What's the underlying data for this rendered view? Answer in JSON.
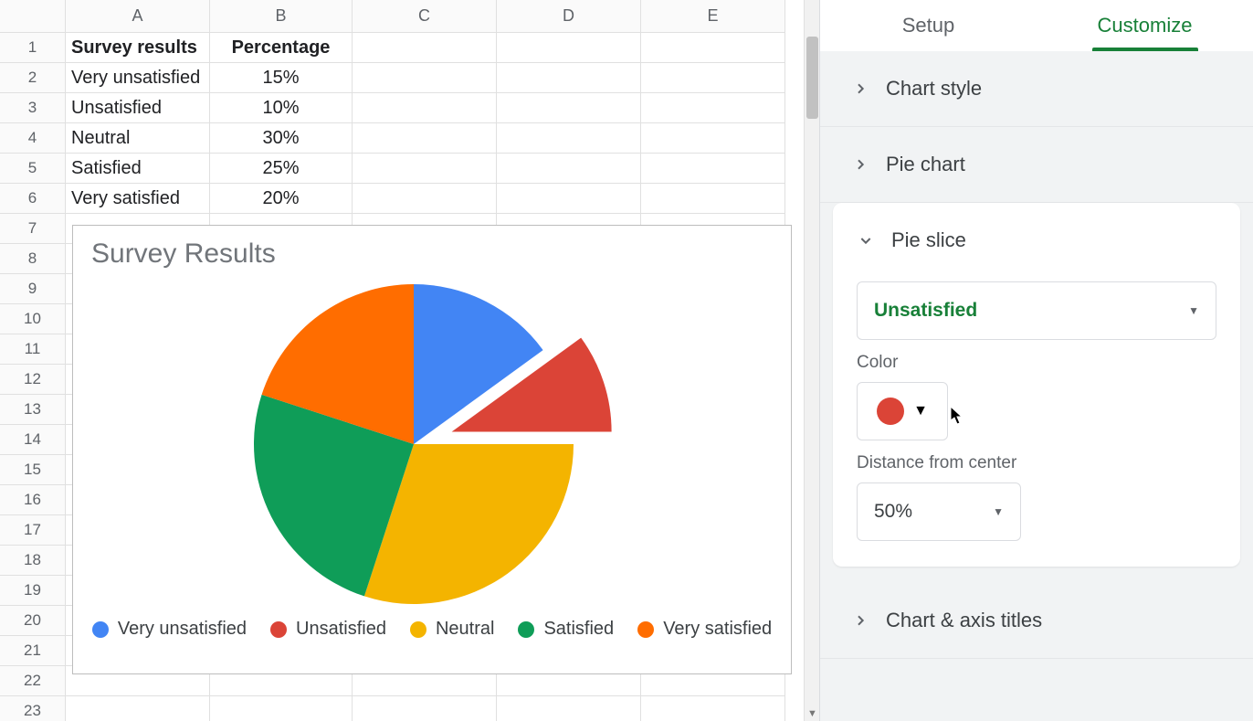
{
  "sheet": {
    "columns": [
      "A",
      "B",
      "C",
      "D",
      "E"
    ],
    "row_count": 23,
    "header_row": {
      "A": "Survey results",
      "B": "Percentage"
    },
    "rows": [
      {
        "A": "Very unsatisfied",
        "B": "15%"
      },
      {
        "A": "Unsatisfied",
        "B": "10%"
      },
      {
        "A": "Neutral",
        "B": "30%"
      },
      {
        "A": "Satisfied",
        "B": "25%"
      },
      {
        "A": "Very satisfied",
        "B": "20%"
      }
    ]
  },
  "chart_data": {
    "type": "pie",
    "title": "Survey Results",
    "categories": [
      "Very unsatisfied",
      "Unsatisfied",
      "Neutral",
      "Satisfied",
      "Very satisfied"
    ],
    "values": [
      15,
      10,
      30,
      25,
      20
    ],
    "colors": [
      "#4285F4",
      "#DB4437",
      "#F4B400",
      "#0F9D58",
      "#FF6D00"
    ],
    "exploded_index": 1,
    "exploded_distance_pct": 50,
    "legend_position": "bottom"
  },
  "panel": {
    "tabs": {
      "setup": "Setup",
      "customize": "Customize",
      "active": "customize"
    },
    "sections": {
      "chart_style": "Chart style",
      "pie_chart": "Pie chart",
      "pie_slice": "Pie slice",
      "chart_axis_titles": "Chart & axis titles"
    },
    "pie_slice": {
      "selected_slice": "Unsatisfied",
      "color_label": "Color",
      "color_value": "#DB4437",
      "distance_label": "Distance from center",
      "distance_value": "50%"
    }
  }
}
